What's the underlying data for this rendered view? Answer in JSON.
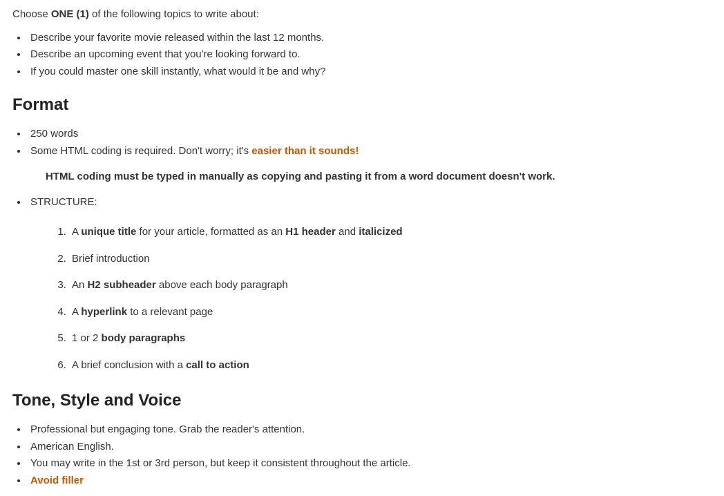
{
  "intro": {
    "prefix": "Choose ",
    "bold": "ONE (1)",
    "suffix": " of the following topics to write about:"
  },
  "topics": [
    "Describe your favorite movie released within the last 12 months.",
    "Describe an upcoming event that you're looking forward to.",
    "If you could master one skill instantly, what would it be and why?"
  ],
  "format": {
    "heading": "Format",
    "word_count": "250 words",
    "html_line": {
      "prefix": "Some HTML coding is required. Don't worry; it's ",
      "link": "easier than it sounds!"
    },
    "note": "HTML coding must be typed in manually as copying and pasting it from a word document doesn't work.",
    "structure_label": "STRUCTURE:",
    "structure": [
      {
        "a": "A ",
        "b": "unique title",
        "c": " for your article, formatted as an ",
        "d": "H1 header",
        "e": " and ",
        "f": "italicized",
        "g": ""
      },
      {
        "a": "Brief introduction",
        "b": "",
        "c": "",
        "d": "",
        "e": "",
        "f": "",
        "g": ""
      },
      {
        "a": "An ",
        "b": "H2 subheader",
        "c": " above each body paragraph",
        "d": "",
        "e": "",
        "f": "",
        "g": ""
      },
      {
        "a": "A ",
        "b": "hyperlink",
        "c": " to a relevant page",
        "d": "",
        "e": "",
        "f": "",
        "g": ""
      },
      {
        "a": "1 or 2 ",
        "b": "body paragraphs",
        "c": "",
        "d": "",
        "e": "",
        "f": "",
        "g": ""
      },
      {
        "a": "A brief conclusion with a ",
        "b": "call to action",
        "c": "",
        "d": "",
        "e": "",
        "f": "",
        "g": ""
      }
    ]
  },
  "tone": {
    "heading": "Tone, Style and Voice",
    "items": [
      {
        "text": "Professional but engaging tone. Grab the reader's attention.",
        "link": ""
      },
      {
        "text": "American English.",
        "link": ""
      },
      {
        "text": "You may write in the 1st or 3rd person, but keep it consistent throughout the article.",
        "link": ""
      },
      {
        "text": "",
        "link": "Avoid filler"
      }
    ]
  }
}
